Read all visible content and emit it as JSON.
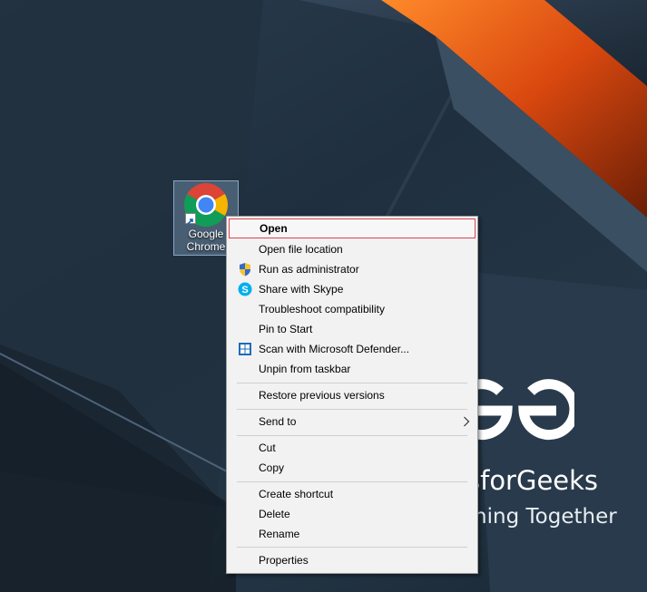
{
  "desktop": {
    "icon": {
      "label_line1": "Google",
      "label_line2": "Chrome"
    },
    "watermark": {
      "line1": "sforGeeks",
      "line2": "rning Together"
    }
  },
  "context_menu": {
    "items": [
      {
        "label": "Open"
      },
      {
        "label": "Open file location"
      },
      {
        "label": "Run as administrator",
        "icon": "uac-shield-icon"
      },
      {
        "label": "Share with Skype",
        "icon": "skype-icon"
      },
      {
        "label": "Troubleshoot compatibility"
      },
      {
        "label": "Pin to Start"
      },
      {
        "label": "Scan with Microsoft Defender...",
        "icon": "defender-icon"
      },
      {
        "label": "Unpin from taskbar"
      },
      {
        "label": "Restore previous versions"
      },
      {
        "label": "Send to",
        "icon": "chevron-right-icon"
      },
      {
        "label": "Cut"
      },
      {
        "label": "Copy"
      },
      {
        "label": "Create shortcut"
      },
      {
        "label": "Delete"
      },
      {
        "label": "Rename"
      },
      {
        "label": "Properties"
      }
    ],
    "highlighted_color": "#e04050"
  }
}
